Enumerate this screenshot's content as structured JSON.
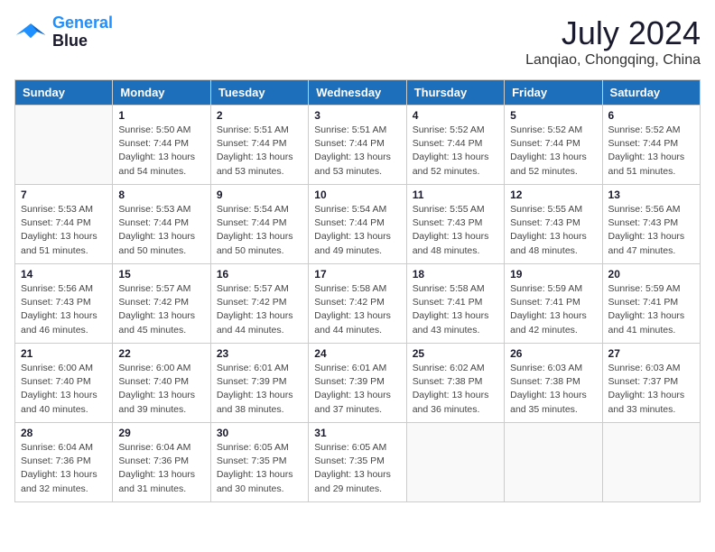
{
  "logo": {
    "line1": "General",
    "line2": "Blue"
  },
  "title": "July 2024",
  "location": "Lanqiao, Chongqing, China",
  "days_header": [
    "Sunday",
    "Monday",
    "Tuesday",
    "Wednesday",
    "Thursday",
    "Friday",
    "Saturday"
  ],
  "weeks": [
    [
      {
        "num": "",
        "empty": true
      },
      {
        "num": "1",
        "rise": "5:50 AM",
        "set": "7:44 PM",
        "daylight": "13 hours and 54 minutes."
      },
      {
        "num": "2",
        "rise": "5:51 AM",
        "set": "7:44 PM",
        "daylight": "13 hours and 53 minutes."
      },
      {
        "num": "3",
        "rise": "5:51 AM",
        "set": "7:44 PM",
        "daylight": "13 hours and 53 minutes."
      },
      {
        "num": "4",
        "rise": "5:52 AM",
        "set": "7:44 PM",
        "daylight": "13 hours and 52 minutes."
      },
      {
        "num": "5",
        "rise": "5:52 AM",
        "set": "7:44 PM",
        "daylight": "13 hours and 52 minutes."
      },
      {
        "num": "6",
        "rise": "5:52 AM",
        "set": "7:44 PM",
        "daylight": "13 hours and 51 minutes."
      }
    ],
    [
      {
        "num": "7",
        "rise": "5:53 AM",
        "set": "7:44 PM",
        "daylight": "13 hours and 51 minutes."
      },
      {
        "num": "8",
        "rise": "5:53 AM",
        "set": "7:44 PM",
        "daylight": "13 hours and 50 minutes."
      },
      {
        "num": "9",
        "rise": "5:54 AM",
        "set": "7:44 PM",
        "daylight": "13 hours and 50 minutes."
      },
      {
        "num": "10",
        "rise": "5:54 AM",
        "set": "7:44 PM",
        "daylight": "13 hours and 49 minutes."
      },
      {
        "num": "11",
        "rise": "5:55 AM",
        "set": "7:43 PM",
        "daylight": "13 hours and 48 minutes."
      },
      {
        "num": "12",
        "rise": "5:55 AM",
        "set": "7:43 PM",
        "daylight": "13 hours and 48 minutes."
      },
      {
        "num": "13",
        "rise": "5:56 AM",
        "set": "7:43 PM",
        "daylight": "13 hours and 47 minutes."
      }
    ],
    [
      {
        "num": "14",
        "rise": "5:56 AM",
        "set": "7:43 PM",
        "daylight": "13 hours and 46 minutes."
      },
      {
        "num": "15",
        "rise": "5:57 AM",
        "set": "7:42 PM",
        "daylight": "13 hours and 45 minutes."
      },
      {
        "num": "16",
        "rise": "5:57 AM",
        "set": "7:42 PM",
        "daylight": "13 hours and 44 minutes."
      },
      {
        "num": "17",
        "rise": "5:58 AM",
        "set": "7:42 PM",
        "daylight": "13 hours and 44 minutes."
      },
      {
        "num": "18",
        "rise": "5:58 AM",
        "set": "7:41 PM",
        "daylight": "13 hours and 43 minutes."
      },
      {
        "num": "19",
        "rise": "5:59 AM",
        "set": "7:41 PM",
        "daylight": "13 hours and 42 minutes."
      },
      {
        "num": "20",
        "rise": "5:59 AM",
        "set": "7:41 PM",
        "daylight": "13 hours and 41 minutes."
      }
    ],
    [
      {
        "num": "21",
        "rise": "6:00 AM",
        "set": "7:40 PM",
        "daylight": "13 hours and 40 minutes."
      },
      {
        "num": "22",
        "rise": "6:00 AM",
        "set": "7:40 PM",
        "daylight": "13 hours and 39 minutes."
      },
      {
        "num": "23",
        "rise": "6:01 AM",
        "set": "7:39 PM",
        "daylight": "13 hours and 38 minutes."
      },
      {
        "num": "24",
        "rise": "6:01 AM",
        "set": "7:39 PM",
        "daylight": "13 hours and 37 minutes."
      },
      {
        "num": "25",
        "rise": "6:02 AM",
        "set": "7:38 PM",
        "daylight": "13 hours and 36 minutes."
      },
      {
        "num": "26",
        "rise": "6:03 AM",
        "set": "7:38 PM",
        "daylight": "13 hours and 35 minutes."
      },
      {
        "num": "27",
        "rise": "6:03 AM",
        "set": "7:37 PM",
        "daylight": "13 hours and 33 minutes."
      }
    ],
    [
      {
        "num": "28",
        "rise": "6:04 AM",
        "set": "7:36 PM",
        "daylight": "13 hours and 32 minutes."
      },
      {
        "num": "29",
        "rise": "6:04 AM",
        "set": "7:36 PM",
        "daylight": "13 hours and 31 minutes."
      },
      {
        "num": "30",
        "rise": "6:05 AM",
        "set": "7:35 PM",
        "daylight": "13 hours and 30 minutes."
      },
      {
        "num": "31",
        "rise": "6:05 AM",
        "set": "7:35 PM",
        "daylight": "13 hours and 29 minutes."
      },
      {
        "num": "",
        "empty": true
      },
      {
        "num": "",
        "empty": true
      },
      {
        "num": "",
        "empty": true
      }
    ]
  ],
  "labels": {
    "sunrise": "Sunrise:",
    "sunset": "Sunset:",
    "daylight": "Daylight:"
  }
}
